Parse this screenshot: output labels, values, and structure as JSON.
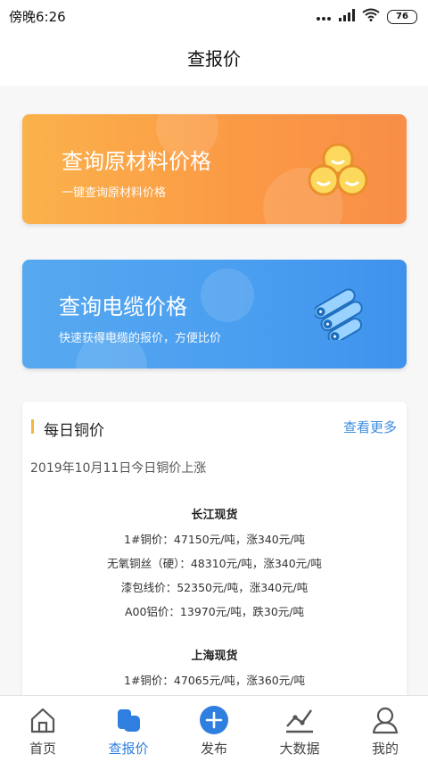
{
  "status_bar": {
    "time": "傍晚6:26",
    "battery": "76"
  },
  "header": {
    "title": "查报价"
  },
  "cards": {
    "materials": {
      "title": "查询原材料价格",
      "subtitle": "一键查询原材料价格",
      "icon": "material-balls-icon"
    },
    "cable": {
      "title": "查询电缆价格",
      "subtitle": "快速获得电缆的报价，方便比价",
      "icon": "cable-bundle-icon"
    }
  },
  "daily_copper": {
    "title": "每日铜价",
    "more_label": "查看更多",
    "date_text": "2019年10月11日今日铜价上涨",
    "markets": [
      {
        "name": "长江现货",
        "lines": [
          "1#铜价：47150元/吨，涨340元/吨",
          "无氧铜丝（硬）：48310元/吨，涨340元/吨",
          "漆包线价：52350元/吨，涨340元/吨",
          "A00铝价：13970元/吨，跌30元/吨"
        ]
      },
      {
        "name": "上海现货",
        "lines": [
          "1#铜价：47065元/吨，涨360元/吨"
        ]
      }
    ]
  },
  "tabbar": {
    "items": [
      {
        "label": "首页",
        "icon": "home-icon",
        "active": false
      },
      {
        "label": "查报价",
        "icon": "quote-icon",
        "active": true
      },
      {
        "label": "发布",
        "icon": "publish-plus-icon",
        "active": false
      },
      {
        "label": "大数据",
        "icon": "chart-icon",
        "active": false
      },
      {
        "label": "我的",
        "icon": "user-icon",
        "active": false
      }
    ]
  },
  "colors": {
    "accent_blue": "#2f7fe0",
    "orange_card": "#fba048",
    "blue_card": "#4a9ef0",
    "section_marker": "#f5b73b"
  }
}
